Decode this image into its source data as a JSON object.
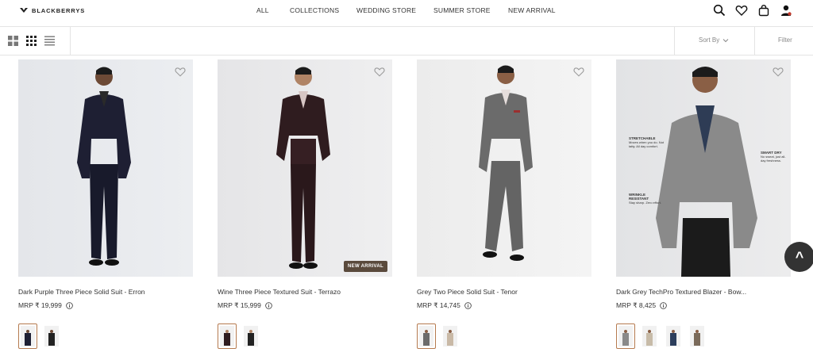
{
  "brand": {
    "name": "BLACKBERRYS"
  },
  "nav": [
    "ALL",
    "COLLECTIONS",
    "WEDDING STORE",
    "SUMMER STORE",
    "NEW ARRIVAL"
  ],
  "header_icons": [
    "search-icon",
    "heart-icon",
    "bag-icon",
    "user-icon"
  ],
  "toolbar": {
    "views": [
      "grid-large-icon",
      "grid-small-icon",
      "list-view-icon"
    ],
    "sort_label": "Sort By",
    "filter_label": "Filter"
  },
  "products": [
    {
      "name": "Dark Purple Three Piece Solid Suit - Erron",
      "price": "MRP ₹ 19,999",
      "badge": "",
      "swatch_count": 2,
      "suit_color": "#1e1f33"
    },
    {
      "name": "Wine Three Piece Textured Suit - Terrazo",
      "price": "MRP ₹ 15,999",
      "badge": "NEW ARRIVAL",
      "swatch_count": 2,
      "suit_color": "#2f1c1f"
    },
    {
      "name": "Grey Two Piece Solid Suit - Tenor",
      "price": "MRP ₹ 14,745",
      "badge": "",
      "swatch_count": 2,
      "suit_color": "#6b6b6b"
    },
    {
      "name": "Dark Grey TechPro Textured Blazer - Bow...",
      "price": "MRP ₹ 8,425",
      "badge": "",
      "swatch_count": 4,
      "suit_color": "#8a8a8a"
    }
  ],
  "blazer_annotations": {
    "stretchable": {
      "title": "STRETCHABLE",
      "text": "Moves when you do. Not tatty. All day comfort."
    },
    "smart_dry": {
      "title": "SMART DRY",
      "text": "No sweat, just all-day freshness."
    },
    "wrinkle": {
      "title": "WRINKLE RESISTANT",
      "text": "Stay sharp. Zero effort."
    }
  },
  "scroll_top_label": "^"
}
